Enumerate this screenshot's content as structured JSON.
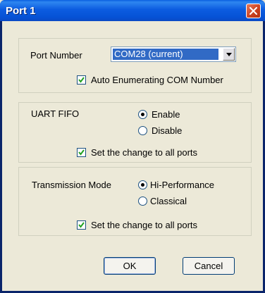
{
  "window": {
    "title": "Port 1"
  },
  "port_number": {
    "label": "Port Number",
    "selected": "COM28 (current)",
    "auto_enum_label": "Auto Enumerating COM Number",
    "auto_enum_checked": true
  },
  "uart_fifo": {
    "label": "UART FIFO",
    "options": [
      "Enable",
      "Disable"
    ],
    "selected": "Enable",
    "apply_all_label": "Set the change to all ports",
    "apply_all_checked": true
  },
  "transmission": {
    "label": "Transmission Mode",
    "options": [
      "Hi-Performance",
      "Classical"
    ],
    "selected": "Hi-Performance",
    "apply_all_label": "Set the change to all ports",
    "apply_all_checked": true
  },
  "buttons": {
    "ok": "OK",
    "cancel": "Cancel"
  }
}
